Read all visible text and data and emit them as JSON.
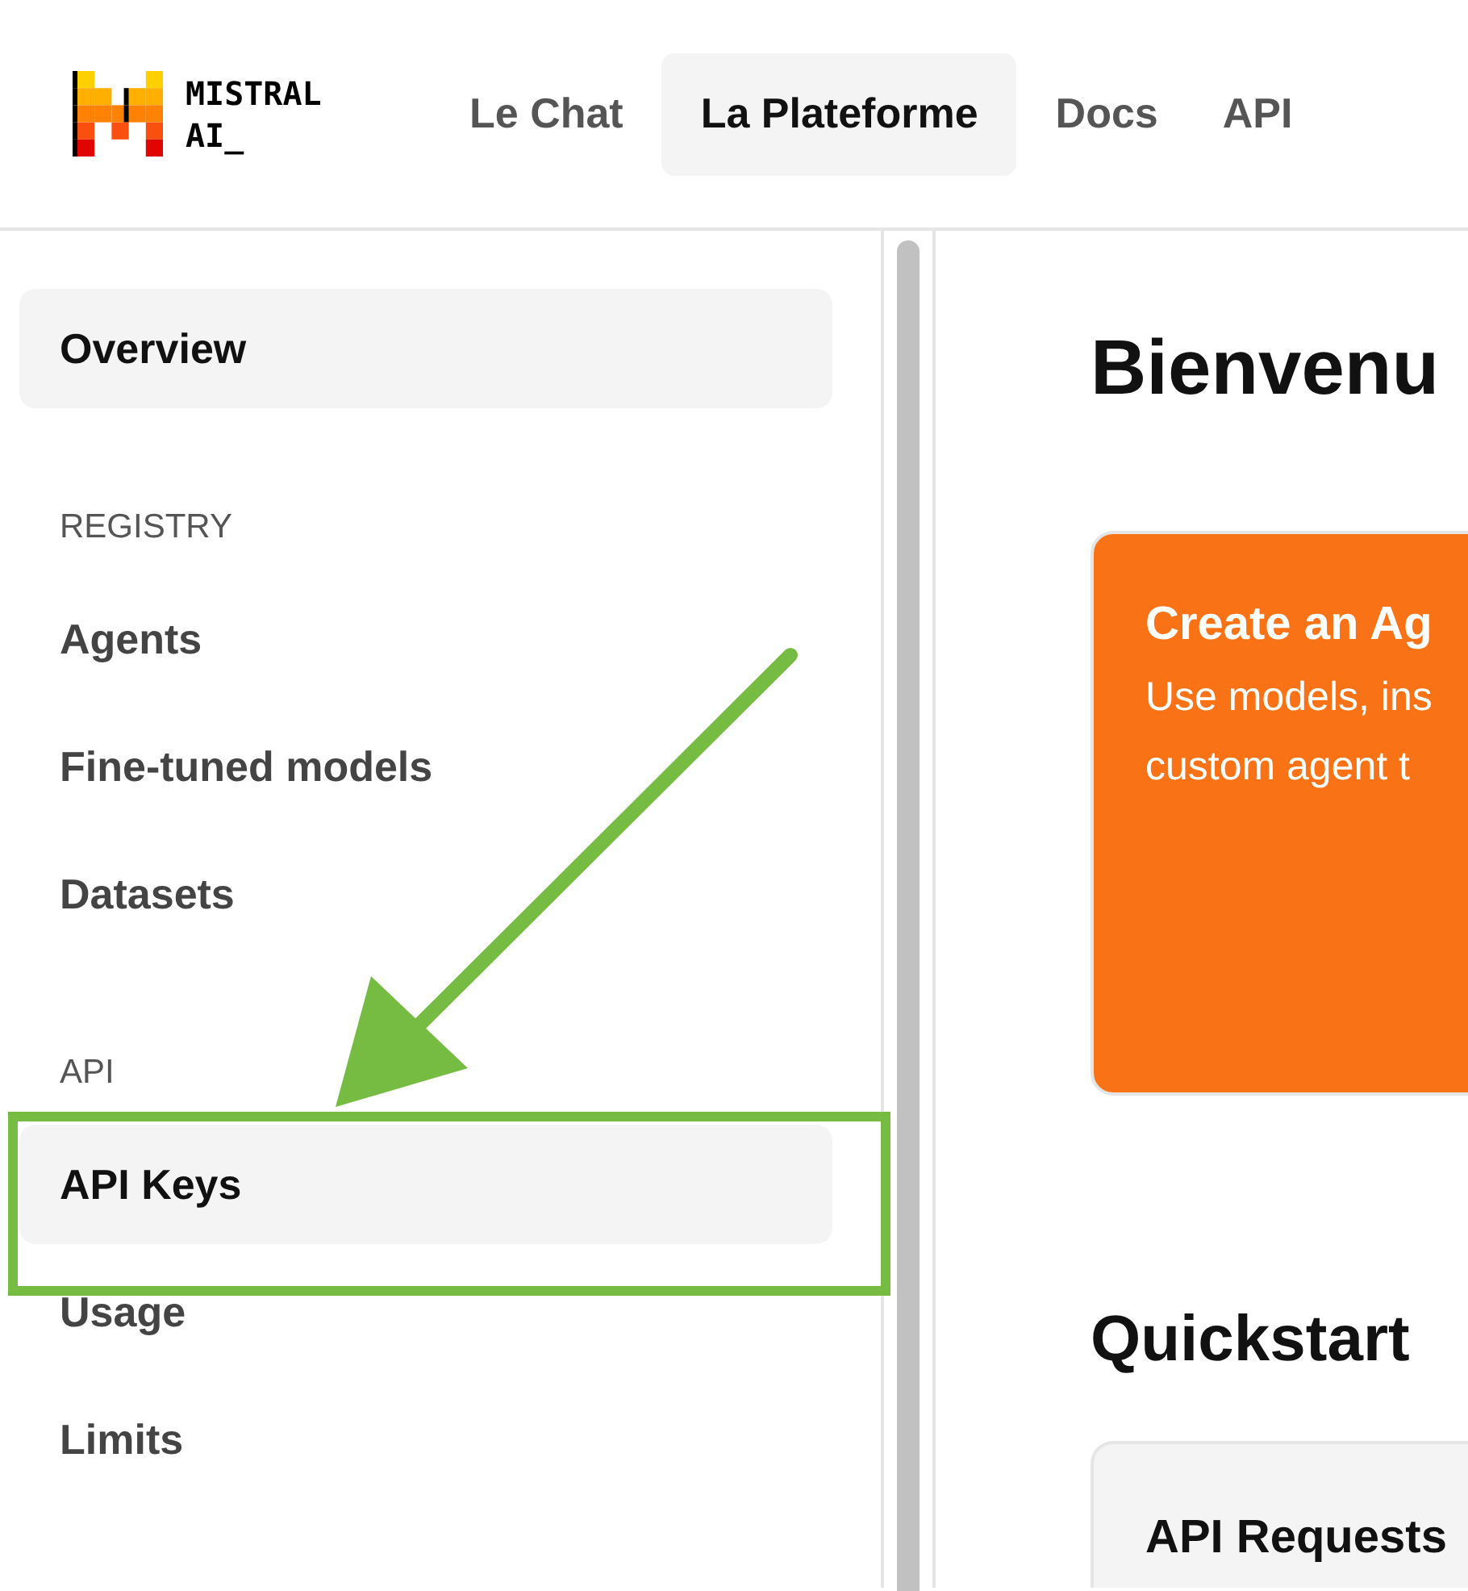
{
  "logo": {
    "text_line_1": "MISTRAL",
    "text_line_2": "AI_"
  },
  "nav": [
    {
      "label": "Le Chat",
      "selected": false
    },
    {
      "label": "La Plateforme",
      "selected": true
    },
    {
      "label": "Docs",
      "selected": false
    },
    {
      "label": "API",
      "selected": false
    }
  ],
  "sidebar": {
    "items": [
      {
        "kind": "item",
        "label": "Overview",
        "selected": true
      },
      {
        "kind": "section",
        "label": "REGISTRY"
      },
      {
        "kind": "item",
        "label": "Agents",
        "selected": false
      },
      {
        "kind": "item",
        "label": "Fine-tuned models",
        "selected": false
      },
      {
        "kind": "item",
        "label": "Datasets",
        "selected": false
      },
      {
        "kind": "section",
        "label": "API"
      },
      {
        "kind": "item",
        "label": "API Keys",
        "selected": true
      },
      {
        "kind": "item",
        "label": "Usage",
        "selected": false
      },
      {
        "kind": "item",
        "label": "Limits",
        "selected": false
      }
    ]
  },
  "main": {
    "heading": "Bienvenu",
    "agent_card": {
      "title": "Create an Ag",
      "description_line_1": "Use models, ins",
      "description_line_2": "custom agent t"
    },
    "quickstart": {
      "heading": "Quickstart",
      "card_title": "API Requests"
    }
  }
}
